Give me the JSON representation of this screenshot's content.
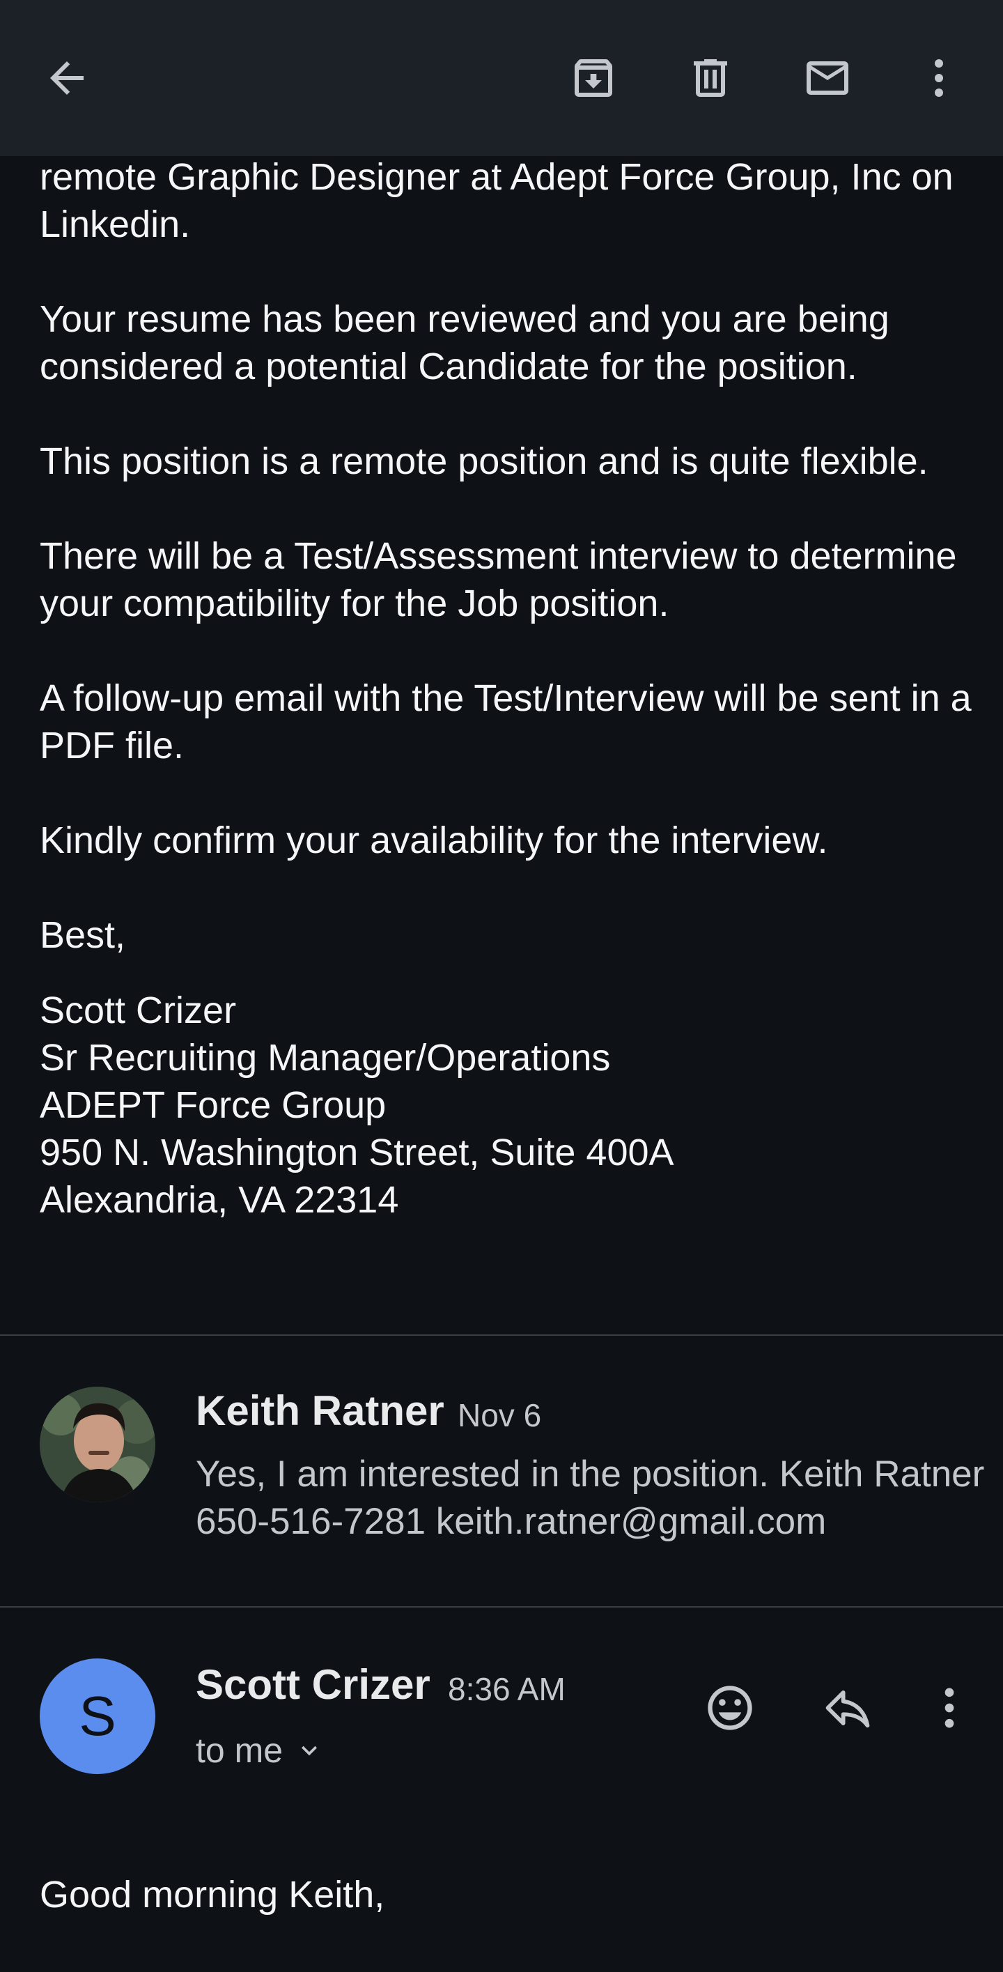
{
  "toolbar": {
    "back_icon": "arrow-back-icon",
    "archive_icon": "archive-icon",
    "delete_icon": "trash-icon",
    "mark_unread_icon": "mail-icon",
    "more_icon": "more-vert-icon"
  },
  "message_body": {
    "paragraphs": [
      "remote Graphic Designer at Adept Force Group, Inc on Linkedin.",
      "Your resume has been reviewed and you are being considered a potential Candidate for the position.",
      "This position is a remote position and is quite flexible.",
      "There will be a Test/Assessment interview to determine your compatibility for the Job position.",
      "A follow-up email with the Test/Interview will be sent in a PDF file.",
      "Kindly confirm your availability for the interview.",
      "Best,"
    ],
    "signature": [
      "Scott Crizer",
      "Sr Recruiting Manager/Operations",
      "ADEPT Force Group",
      "950 N. Washington Street, Suite 400A",
      "Alexandria, VA 22314"
    ]
  },
  "collapsed_message": {
    "sender": "Keith Ratner",
    "date": "Nov 6",
    "snippet": "Yes, I am interested in the position. Keith Ratner 650-516-7281 keith.ratner@gmail.com"
  },
  "open_message": {
    "avatar_letter": "S",
    "avatar_color": "#5b8def",
    "sender": "Scott Crizer",
    "time": "8:36 AM",
    "recipient": "to me",
    "greeting": "Good morning Keith,"
  },
  "colors": {
    "background": "#0e1116",
    "toolbar": "#1c2027",
    "accent_avatar": "#5b8def"
  }
}
